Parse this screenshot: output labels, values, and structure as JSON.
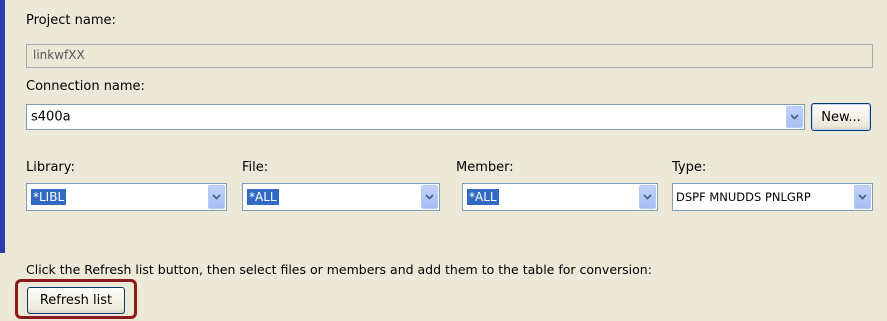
{
  "project": {
    "label": "Project name:",
    "value": "linkwfXX"
  },
  "connection": {
    "label": "Connection name:",
    "value": "s400a",
    "new_button": "New..."
  },
  "filters": {
    "library": {
      "label": "Library:",
      "value": "*LIBL"
    },
    "file": {
      "label": "File:",
      "value": "*ALL"
    },
    "member": {
      "label": "Member:",
      "value": "*ALL"
    },
    "type": {
      "label": "Type:",
      "value": "DSPF MNUDDS PNLGRP"
    }
  },
  "instruction": "Click the Refresh list button, then select files or members and add them to the table for conversion:",
  "refresh_button": "Refresh list",
  "colors": {
    "selection": "#316ac5",
    "accent_bar": "#2a3cae",
    "highlight_border": "#8b1a1a"
  },
  "icons": [
    "chevron-down-icon"
  ]
}
